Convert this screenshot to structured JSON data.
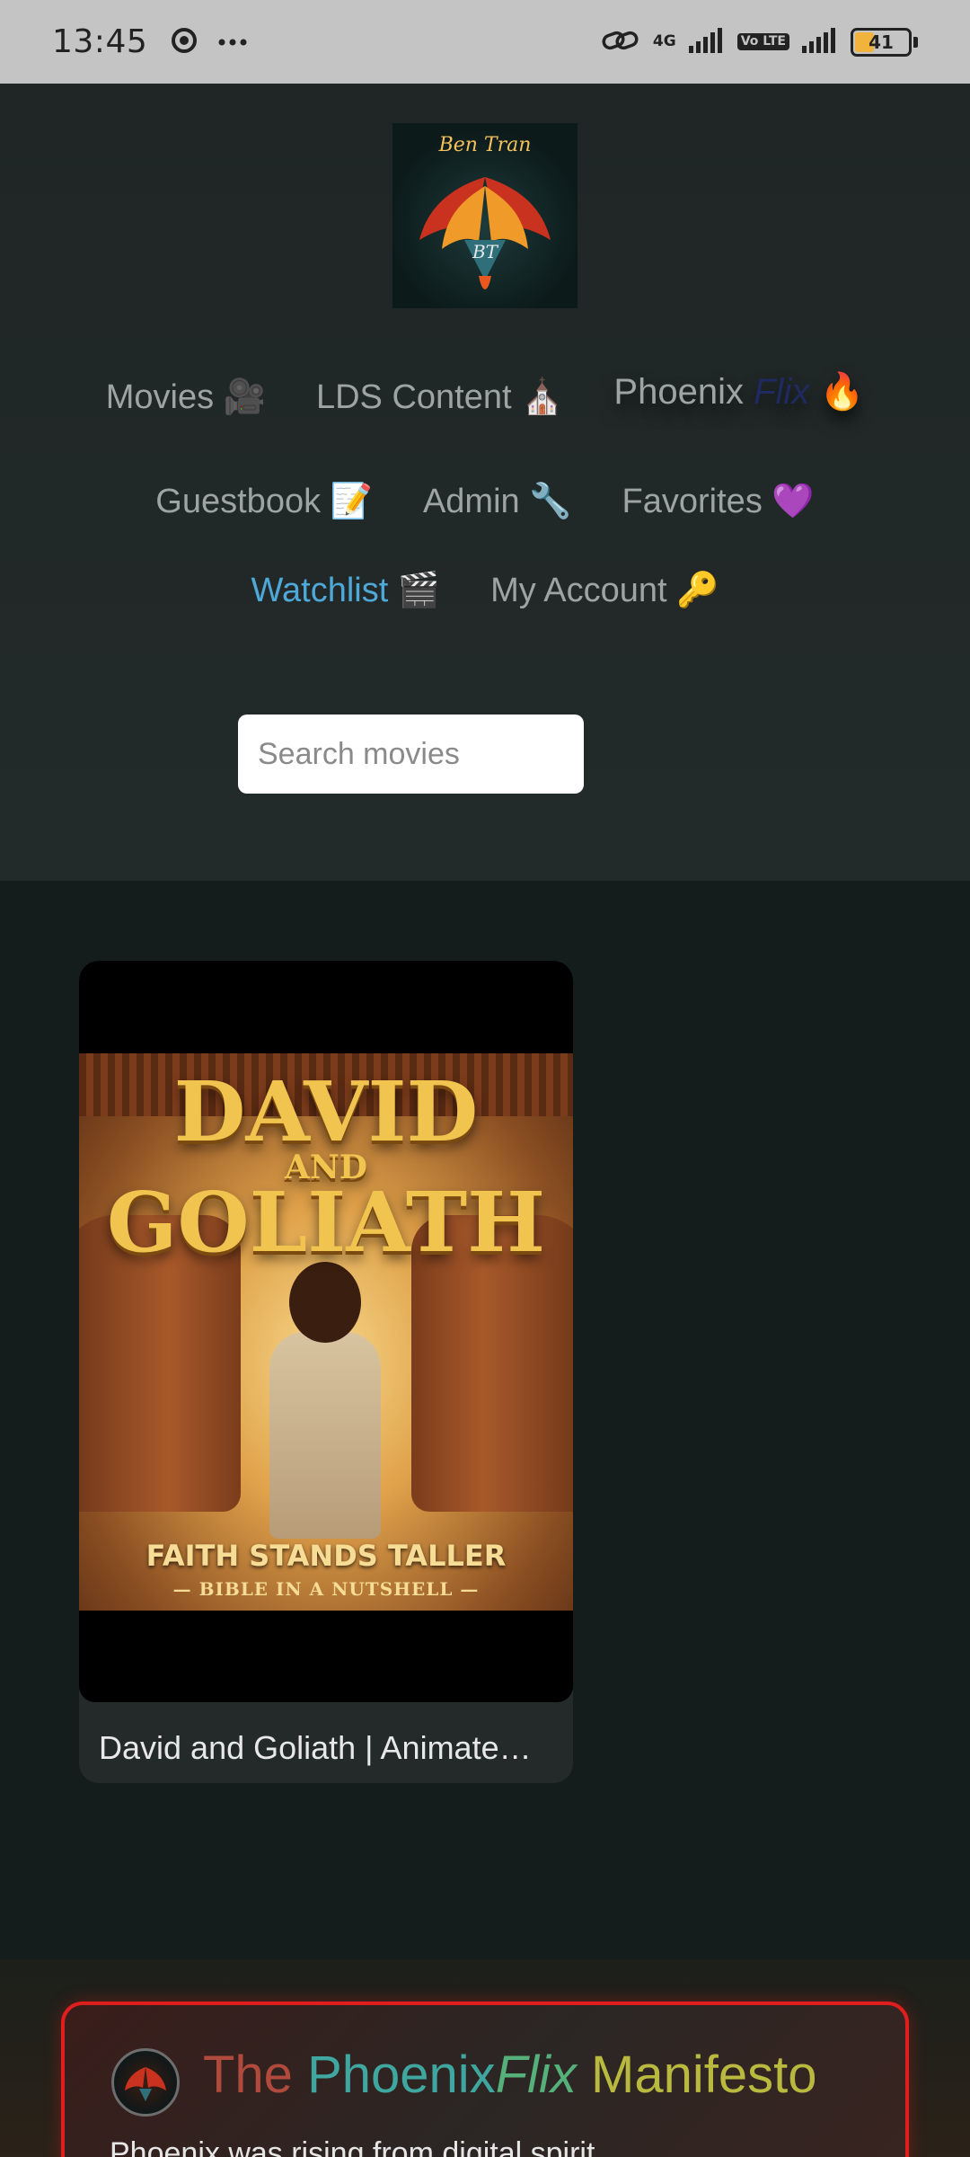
{
  "status_bar": {
    "time": "13:45",
    "network_label": "4G",
    "volte_label": "Vo LTE",
    "battery": "41",
    "battery_level": 0.41,
    "icons": [
      "chrome-icon",
      "more-dots-icon",
      "link-icon",
      "signal-icon",
      "signal-icon-2",
      "battery-icon"
    ]
  },
  "header": {
    "logo_text": "Ben Tran",
    "nav": {
      "movies": "Movies 🎥",
      "lds": "LDS Content ⛪",
      "brand_phoenix": "Phoenix",
      "brand_flix": "Flix",
      "brand_emoji": "🔥",
      "guestbook": "Guestbook 📝",
      "admin": "Admin 🔧",
      "favorites": "Favorites 💜",
      "watchlist": "Watchlist 🎬",
      "account": "My Account 🔑"
    },
    "search_placeholder": "Search movies"
  },
  "movies": [
    {
      "title": "David and Goliath | Animated Bible Story",
      "poster_title_1": "DAVID",
      "poster_and": "AND",
      "poster_title_2": "GOLIATH",
      "poster_tagline": "FAITH STANDS TALLER",
      "poster_subline": "— BIBLE IN A NUTSHELL —"
    }
  ],
  "manifesto": {
    "title_the": "The",
    "title_phoenix": "Phoenix",
    "title_flix": "Flix",
    "title_manifesto": "Manifesto",
    "text": "Phoenix was rising from digital spirit…"
  },
  "colors": {
    "brand_red": "#e0140f",
    "watchlist_blue": "#4ea8d8",
    "manifesto_border": "#e01e1e"
  }
}
